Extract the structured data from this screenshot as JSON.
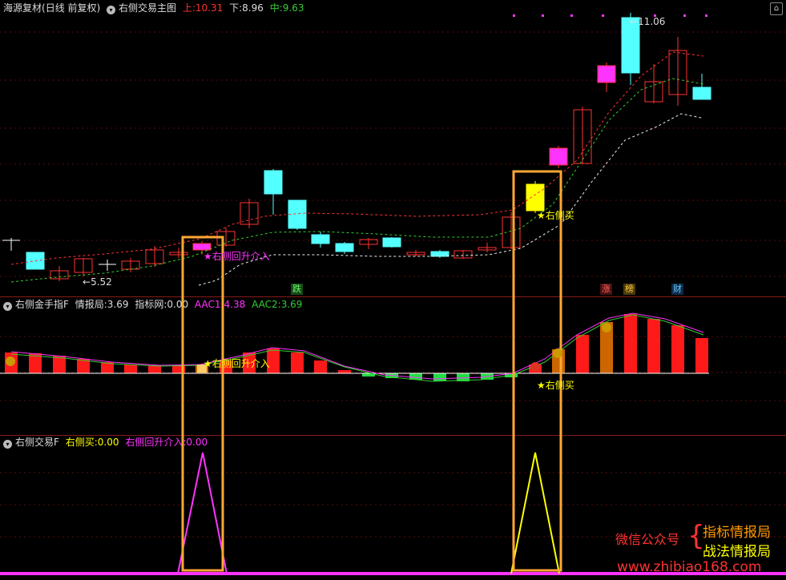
{
  "main_panel": {
    "stock_name": "海源复材",
    "period": "(日线 前复权)",
    "indicator": "右侧交易主图",
    "upper_label": "上:",
    "upper_value": "10.31",
    "lower_label": "下:",
    "lower_value": "8.96",
    "mid_label": "中:",
    "mid_value": "9.63",
    "high_price": "11.06",
    "low_price": "5.52",
    "buy_signal": "★右侧买",
    "rebound_signal": "★右侧回升介入",
    "badges": [
      "跌",
      "涨",
      "榜",
      "财"
    ]
  },
  "panel2": {
    "indicator": "右侧金手指F",
    "info_label": "情报局:",
    "info_value": "3.69",
    "net_label": "指标网:",
    "net_value": "0.00",
    "aac1_label": "AAC1:",
    "aac1_value": "4.38",
    "aac2_label": "AAC2:",
    "aac2_value": "3.69",
    "rebound_signal": "★右侧回升介入",
    "buy_signal": "★右侧买"
  },
  "panel3": {
    "indicator": "右侧交易F",
    "buy_label": "右侧买:",
    "buy_value": "0.00",
    "rebound_label": "右侧回升介入:",
    "rebound_value": "0.00"
  },
  "watermark": {
    "wechat": "微信公众号",
    "line1": "指标情报局",
    "line2": "战法情报局",
    "url": "www.zhibiao168.com"
  },
  "colors": {
    "up": "#ff3232",
    "down": "#54ffff",
    "highlight_box": "#ffa733",
    "magenta": "#ff33ff",
    "yellow": "#ffff00",
    "green_ma": "#33cc33"
  }
}
